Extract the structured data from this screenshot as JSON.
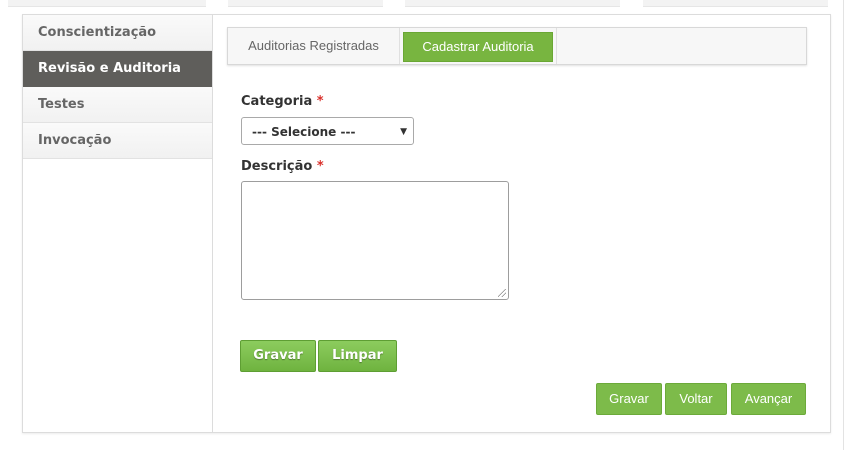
{
  "sidebar": {
    "items": [
      {
        "label": "Conscientização"
      },
      {
        "label": "Revisão e Auditoria"
      },
      {
        "label": "Testes"
      },
      {
        "label": "Invocação"
      }
    ],
    "active_index": 1
  },
  "tabs": [
    {
      "label": "Auditorias Registradas"
    },
    {
      "label": "Cadastrar Auditoria"
    }
  ],
  "form": {
    "categoria_label": "Categoria",
    "categoria_selected": "--- Selecione ---",
    "descricao_label": "Descrição",
    "descricao_value": "",
    "required_mark": "*"
  },
  "buttons": {
    "gravar": "Gravar",
    "limpar": "Limpar"
  },
  "footer_buttons": {
    "gravar": "Gravar",
    "voltar": "Voltar",
    "avancar": "Avançar"
  },
  "colors": {
    "accent_green": "#78b540",
    "sidebar_active": "#5f5e5b",
    "required": "#d9302b"
  }
}
